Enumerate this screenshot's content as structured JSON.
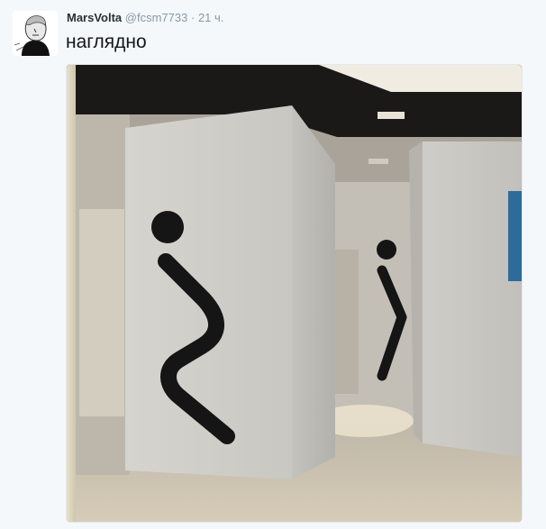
{
  "tweet": {
    "display_name": "MarsVolta",
    "handle": "@fcsm7733",
    "separator": "·",
    "timestamp": "21 ч.",
    "text": "наглядно"
  },
  "media": {
    "alt": "restroom-signage-photo"
  },
  "colors": {
    "background": "#f5f8fa",
    "name": "#292f33",
    "meta": "#8899a6",
    "text": "#14171a"
  }
}
